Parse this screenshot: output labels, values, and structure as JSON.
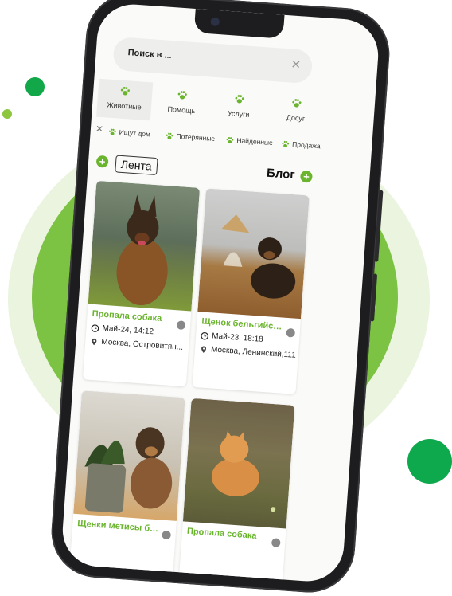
{
  "colors": {
    "accent": "#6ab42e",
    "circle_big": "#7cc243",
    "circle_light": "#eaf4df",
    "dot_dark": "#12a84a"
  },
  "search": {
    "text": "Поиск в ...",
    "close_icon": "close-icon"
  },
  "categories": [
    {
      "label": "Животные",
      "icon": "paw-icon",
      "active": true
    },
    {
      "label": "Помощь",
      "icon": "paw-icon"
    },
    {
      "label": "Услуги",
      "icon": "paw-icon"
    },
    {
      "label": "Досуг",
      "icon": "paw-icon"
    }
  ],
  "subcategories": [
    {
      "label": "Ищут дом"
    },
    {
      "label": "Потерянные"
    },
    {
      "label": "Найденные"
    },
    {
      "label": "Продажа"
    }
  ],
  "feed": {
    "tab_feed": "Лента",
    "tab_blog": "Блог",
    "add_symbol": "+"
  },
  "cards": [
    {
      "title": "Пропала собака",
      "date": "Май-24, 14:12",
      "location": "Москва, Островитян..."
    },
    {
      "title": "Щенок бельгийско...",
      "date": "Май-23, 18:18",
      "location": "Москва, Ленинский,111"
    },
    {
      "title": "Щенки метисы бе..."
    },
    {
      "title": "Пропала собака"
    }
  ]
}
